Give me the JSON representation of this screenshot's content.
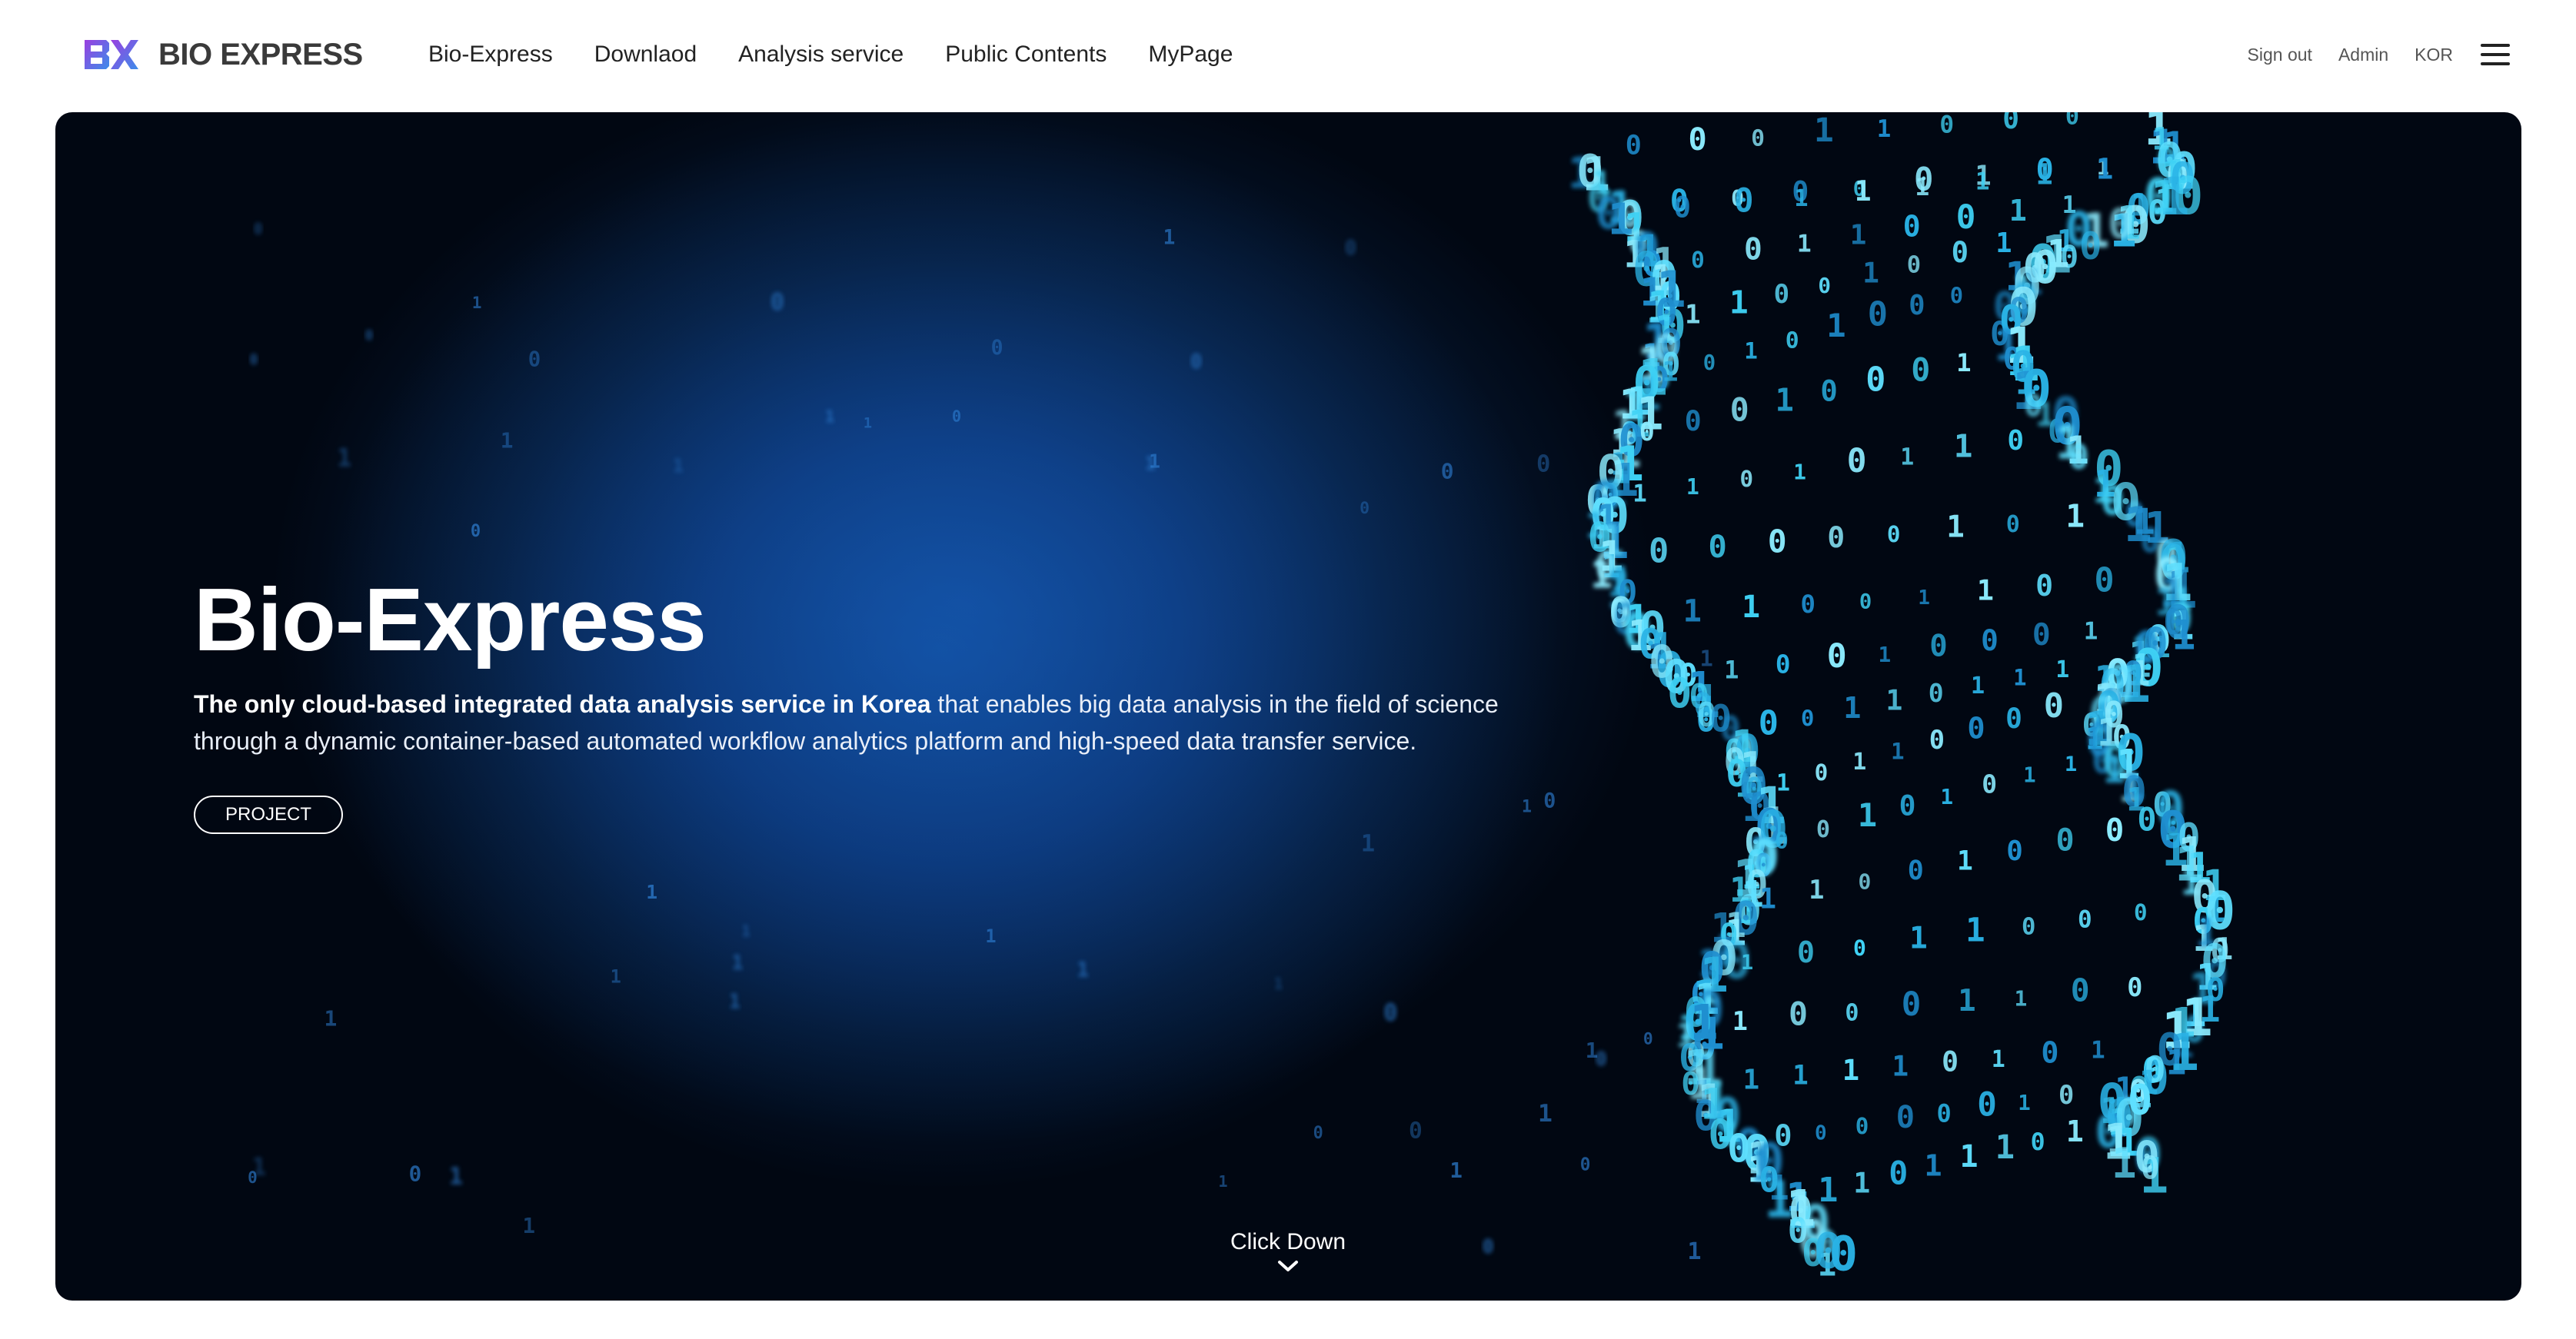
{
  "header": {
    "logo_text": "BIO EXPRESS",
    "logo_mark": "BX",
    "nav": [
      "Bio-Express",
      "Downlaod",
      "Analysis service",
      "Public Contents",
      "MyPage"
    ],
    "util": [
      "Sign out",
      "Admin",
      "KOR"
    ],
    "menu_icon": "hamburger-menu-icon"
  },
  "hero": {
    "title": "Bio-Express",
    "desc_bold": "The only cloud-based integrated data analysis service in Korea",
    "desc_rest_line1": " that enables big data analysis in the field of science",
    "desc_line2": "through a dynamic container-based automated workflow analytics platform and high-speed data transfer service.",
    "project_label": "PROJECT",
    "click_down_label": "Click Down",
    "click_down_icon": "chevron-down-icon",
    "background_image": "binary DNA helix",
    "colors": {
      "accent": "#34c6ee",
      "logo_gradient_start": "#7b3fe4",
      "logo_gradient_end": "#3c8dea"
    }
  }
}
